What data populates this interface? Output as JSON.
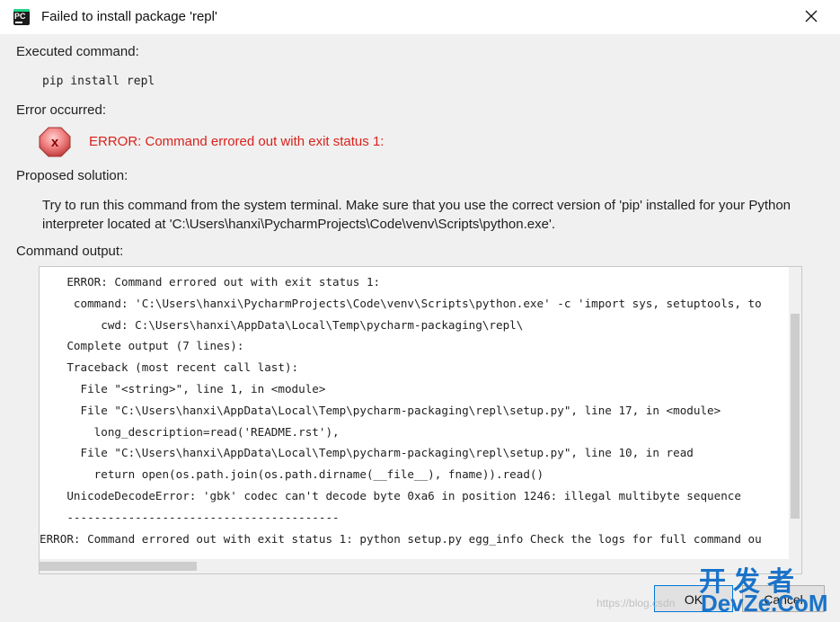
{
  "window": {
    "title": "Failed to install package 'repl'",
    "app_icon_text": "PC",
    "close_icon": "close-x-icon"
  },
  "executed": {
    "label": "Executed command:",
    "command": "pip install repl"
  },
  "error": {
    "label": "Error occurred:",
    "icon": "error-x-icon",
    "icon_glyph": "x",
    "message": "ERROR: Command errored out with exit status 1:"
  },
  "solution": {
    "label": "Proposed solution:",
    "text": "Try to run this command from the system terminal. Make sure that you use the correct version of 'pip' installed for your Python interpreter located at 'C:\\Users\\hanxi\\PycharmProjects\\Code\\venv\\Scripts\\python.exe'."
  },
  "output": {
    "label": "Command output:",
    "lines": [
      "    ERROR: Command errored out with exit status 1:",
      "     command: 'C:\\Users\\hanxi\\PycharmProjects\\Code\\venv\\Scripts\\python.exe' -c 'import sys, setuptools, to",
      "         cwd: C:\\Users\\hanxi\\AppData\\Local\\Temp\\pycharm-packaging\\repl\\",
      "    Complete output (7 lines):",
      "    Traceback (most recent call last):",
      "      File \"<string>\", line 1, in <module>",
      "      File \"C:\\Users\\hanxi\\AppData\\Local\\Temp\\pycharm-packaging\\repl\\setup.py\", line 17, in <module>",
      "        long_description=read('README.rst'),",
      "      File \"C:\\Users\\hanxi\\AppData\\Local\\Temp\\pycharm-packaging\\repl\\setup.py\", line 10, in read",
      "        return open(os.path.join(os.path.dirname(__file__), fname)).read()",
      "    UnicodeDecodeError: 'gbk' codec can't decode byte 0xa6 in position 1246: illegal multibyte sequence",
      "    ----------------------------------------",
      "ERROR: Command errored out with exit status 1: python setup.py egg_info Check the logs for full command ou"
    ]
  },
  "buttons": {
    "ok": "OK",
    "cancel": "Cancel"
  },
  "watermark": {
    "url": "https://blog.csdn",
    "brand_top": "开发者",
    "brand_bottom": "DevZe.CoM"
  },
  "colors": {
    "error_text": "#d9221c",
    "dialog_bg": "#f0f0f0",
    "brand": "#1a73c8"
  }
}
